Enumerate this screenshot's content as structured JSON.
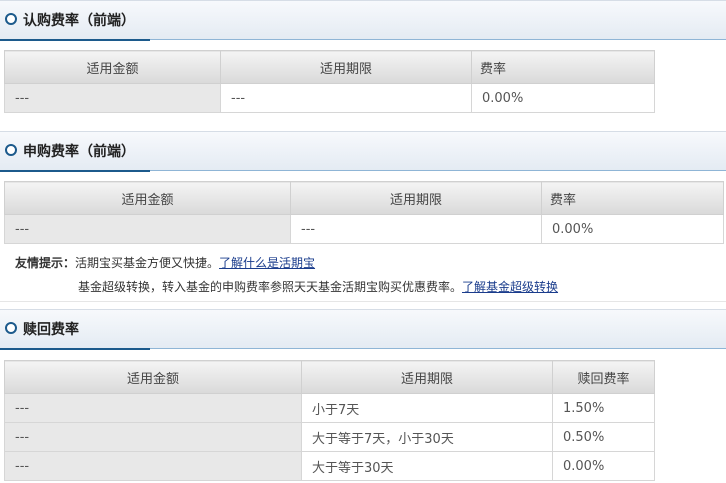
{
  "section1": {
    "title": "认购费率（前端）",
    "headers": [
      "适用金额",
      "适用期限",
      "费率"
    ],
    "rows": [
      [
        "---",
        "---",
        "0.00%"
      ]
    ]
  },
  "section2": {
    "title": "申购费率（前端）",
    "headers": [
      "适用金额",
      "适用期限",
      "费率"
    ],
    "rows": [
      [
        "---",
        "---",
        "0.00%"
      ]
    ],
    "tip_label": "友情提示：",
    "tip_text": "活期宝买基金方便又快捷。",
    "tip_link": "了解什么是活期宝",
    "tip2_text": "基金超级转换，转入基金的申购费率参照天天基金活期宝购买优惠费率。",
    "tip2_link": "了解基金超级转换"
  },
  "section3": {
    "title": "赎回费率",
    "headers": [
      "适用金额",
      "适用期限",
      "赎回费率"
    ],
    "rows": [
      [
        "---",
        "小于7天",
        "1.50%"
      ],
      [
        "---",
        "大于等于7天，小于30天",
        "0.50%"
      ],
      [
        "---",
        "大于等于30天",
        "0.00%"
      ]
    ]
  }
}
